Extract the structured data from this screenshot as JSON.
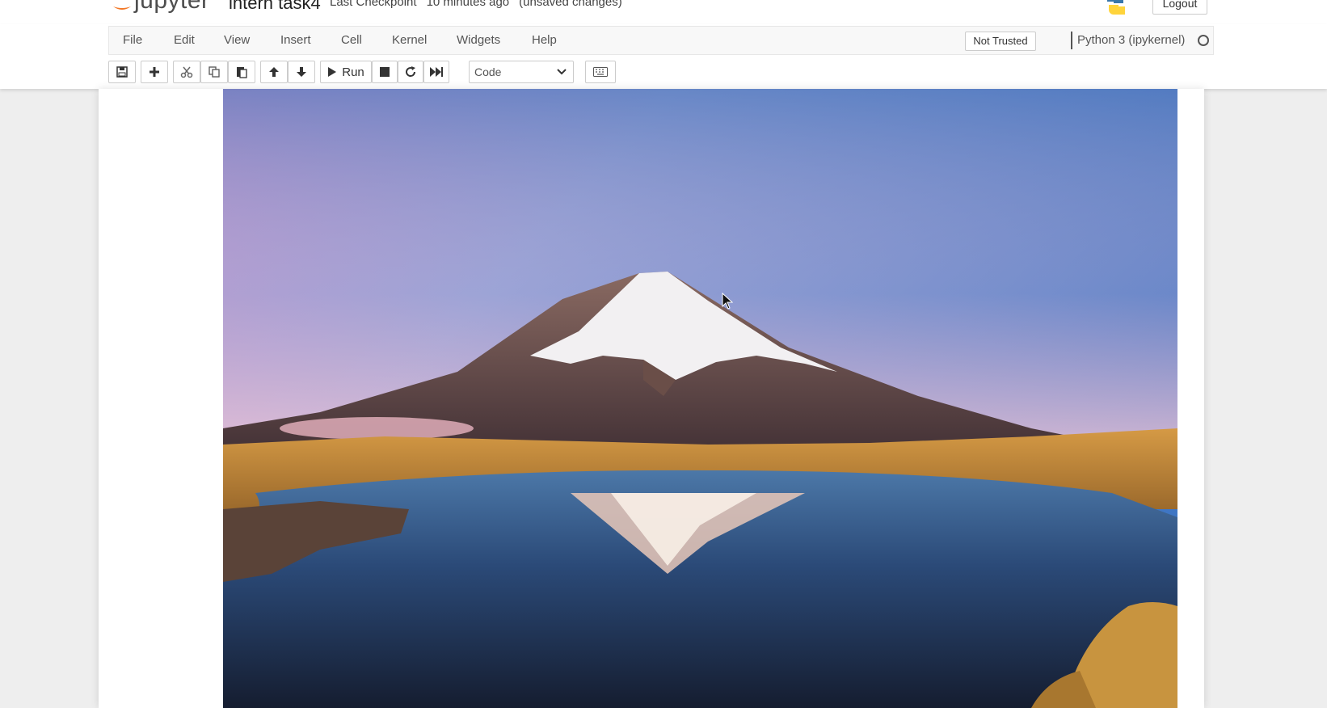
{
  "app": {
    "logo_text": "jupyter",
    "notebook_name": "intern task4",
    "checkpoint_label": "Last Checkpoint",
    "checkpoint_time": "10 minutes ago",
    "unsaved": "(unsaved changes)",
    "logout_label": "Logout"
  },
  "menubar": {
    "items": [
      "File",
      "Edit",
      "View",
      "Insert",
      "Cell",
      "Kernel",
      "Widgets",
      "Help"
    ],
    "trust_label": "Not Trusted",
    "kernel_name": "Python 3 (ipykernel)"
  },
  "toolbar": {
    "run_label": "Run",
    "cell_type_selected": "Code",
    "icons": [
      "save-icon",
      "plus-icon",
      "cut-icon",
      "copy-icon",
      "paste-icon",
      "arrow-up-icon",
      "arrow-down-icon",
      "play-icon",
      "stop-icon",
      "restart-icon",
      "fast-forward-icon",
      "keyboard-icon"
    ]
  },
  "output": {
    "image_subject": "snow-capped mountain reflected in lake at sunrise"
  },
  "colors": {
    "sky_top": "#3f76c4",
    "sky_pink": "#e7b3cf",
    "grass": "#c98b35",
    "lake": "#1a2b4a"
  }
}
